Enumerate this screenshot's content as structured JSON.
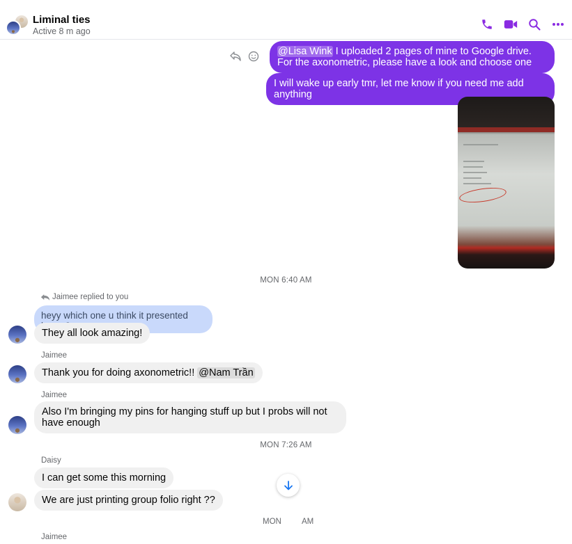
{
  "header": {
    "title": "Liminal ties",
    "status": "Active 8 m ago",
    "actions": [
      "phone-icon",
      "video-icon",
      "search-icon",
      "more-icon"
    ],
    "accent": "#7d33e6"
  },
  "messages": {
    "out_1": {
      "mention": "@Lisa Wink",
      "text": " I uploaded 2 pages of mine to Google drive. For the axonometric, please have a look and choose one"
    },
    "out_2": {
      "text": "I will wake up early tmr, let me know if you need me add anything"
    },
    "out_photo": {
      "kind": "photo",
      "icon": "photo-of-screen"
    },
    "sep_1": "MON 6:40 AM",
    "reply_hint": "Jaimee replied to you",
    "quoted": "heyy which one u think it presented better?",
    "in_1": {
      "text": "They all look amazing!"
    },
    "sender_2": "Jaimee",
    "in_2": {
      "text": "Thank you for doing axonometric!! ",
      "mention": "@Nam Trần"
    },
    "sender_3": "Jaimee",
    "in_3": {
      "text": "Also I'm bringing my pins for hanging stuff up but I probs will not have enough"
    },
    "sep_2": "MON 7:26 AM",
    "sender_4": "Daisy",
    "in_4": {
      "text": "I can get some this morning"
    },
    "in_5": {
      "text": "We are just printing group folio right ??"
    },
    "sep_3_left": "MON",
    "sep_3_right": "AM",
    "sender_5": "Jaimee"
  },
  "colors": {
    "outgoing": "#7d33e6",
    "incoming": "#f0f0f0",
    "quoted": "#c9d9fb",
    "meta": "#65676b"
  }
}
